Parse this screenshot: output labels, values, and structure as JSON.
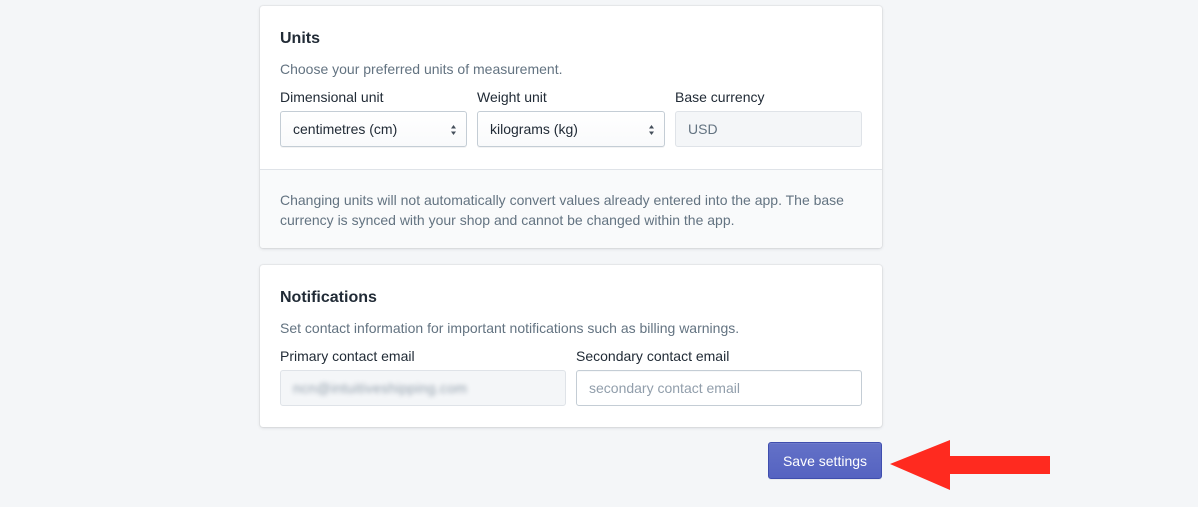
{
  "units": {
    "title": "Units",
    "description": "Choose your preferred units of measurement.",
    "dimensional": {
      "label": "Dimensional unit",
      "value": "centimetres (cm)"
    },
    "weight": {
      "label": "Weight unit",
      "value": "kilograms (kg)"
    },
    "currency": {
      "label": "Base currency",
      "value": "USD"
    },
    "footer_note": "Changing units will not automatically convert values already entered into the app. The base currency is synced with your shop and cannot be changed within the app."
  },
  "notifications": {
    "title": "Notifications",
    "description": "Set contact information for important notifications such as billing warnings.",
    "primary": {
      "label": "Primary contact email",
      "value": "ncn@intuitiveshipping.com"
    },
    "secondary": {
      "label": "Secondary contact email",
      "placeholder": "secondary contact email"
    }
  },
  "actions": {
    "save_label": "Save settings"
  },
  "colors": {
    "primary_button": "#5c6ac4",
    "annotation_arrow": "#ff2a1f"
  }
}
